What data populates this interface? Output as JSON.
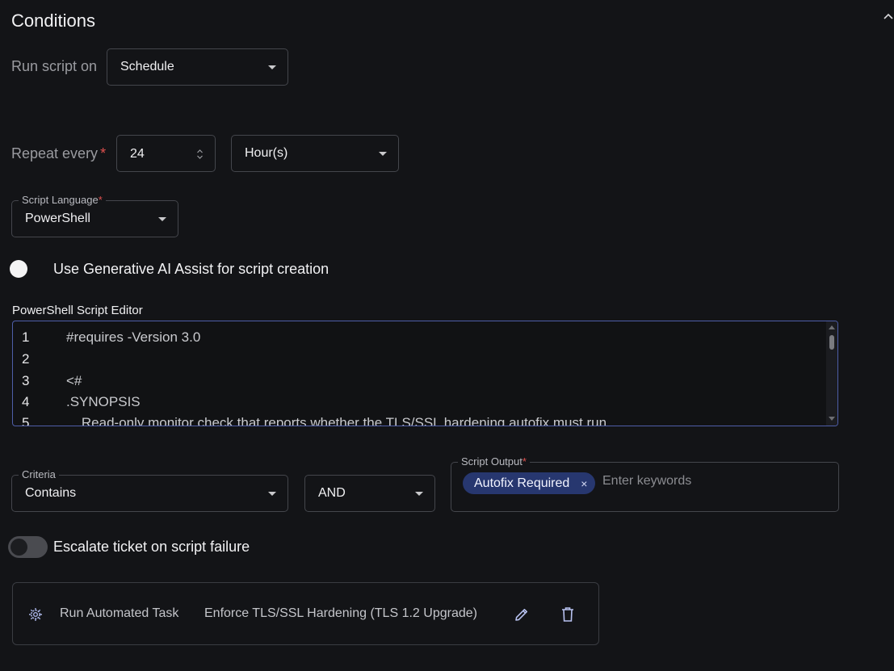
{
  "section": {
    "title": "Conditions"
  },
  "run_script": {
    "label": "Run script on",
    "value": "Schedule"
  },
  "repeat": {
    "label": "Repeat every",
    "required_mark": "*",
    "value": "24",
    "unit": "Hour(s)"
  },
  "script_language": {
    "label": "Script Language",
    "required_mark": "*",
    "value": "PowerShell"
  },
  "gen_ai": {
    "label": "Use Generative AI Assist for script creation",
    "enabled": false
  },
  "editor": {
    "label": "PowerShell Script Editor",
    "lines": [
      {
        "num": "1",
        "text": "#requires -Version 3.0"
      },
      {
        "num": "2",
        "text": ""
      },
      {
        "num": "3",
        "text": "<#"
      },
      {
        "num": "4",
        "text": ".SYNOPSIS"
      },
      {
        "num": "5",
        "text": "    Read-only monitor check that reports whether the TLS/SSL hardening autofix must run."
      }
    ]
  },
  "criteria": {
    "label": "Criteria",
    "value": "Contains"
  },
  "operator": {
    "value": "AND"
  },
  "script_output": {
    "label": "Script Output",
    "required_mark": "*",
    "chip": "Autofix Required",
    "chip_remove": "×",
    "placeholder": "Enter keywords"
  },
  "escalate": {
    "label": "Escalate ticket on script failure",
    "enabled": false
  },
  "task": {
    "type_label": "Run Automated Task",
    "name": "Enforce TLS/SSL Hardening (TLS 1.2 Upgrade)"
  },
  "icons": {
    "collapse": "chevron-up-icon",
    "dropdown": "caret-down-icon",
    "stepper": "stepper-icon",
    "task": "gear-automation-icon",
    "edit": "pencil-icon",
    "delete": "trash-icon"
  },
  "colors": {
    "background": "#131417",
    "accent": "#27376f",
    "editor_border": "#4e5ea8",
    "required": "#e0514f"
  }
}
